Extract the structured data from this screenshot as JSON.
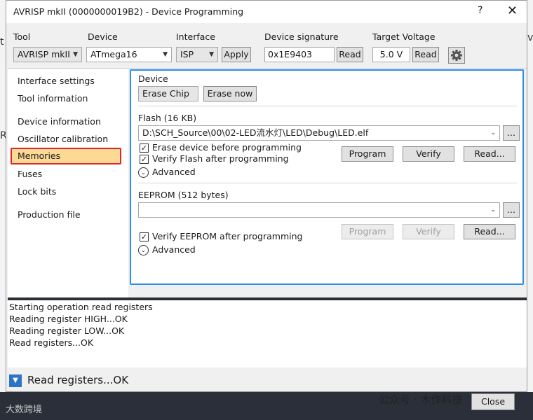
{
  "window": {
    "title": "AVRISP mkII (0000000019B2) - Device Programming",
    "help": "?",
    "close": "✕"
  },
  "toolbar": {
    "tool_label": "Tool",
    "tool_value": "AVRISP mkII",
    "device_label": "Device",
    "device_value": "ATmega16",
    "interface_label": "Interface",
    "interface_value": "ISP",
    "apply": "Apply",
    "signature_label": "Device signature",
    "signature_value": "0x1E9403",
    "signature_read": "Read",
    "voltage_label": "Target Voltage",
    "voltage_value": "5.0 V",
    "voltage_read": "Read"
  },
  "nav": {
    "items": [
      "Interface settings",
      "Tool information",
      "Device information",
      "Oscillator calibration",
      "Memories",
      "Fuses",
      "Lock bits",
      "Production file"
    ],
    "active": "Memories"
  },
  "memories": {
    "device_heading": "Device",
    "erase_mode": "Erase Chip",
    "erase_now": "Erase now",
    "flash_heading": "Flash (16 KB)",
    "flash_path": "D:\\SCH_Source\\00\\02-LED流水灯\\LED\\Debug\\LED.elf",
    "browse": "...",
    "erase_before": "Erase device before programming",
    "verify_flash": "Verify Flash after programming",
    "erase_before_checked": "✓",
    "verify_flash_checked": "✓",
    "program": "Program",
    "verify": "Verify",
    "read": "Read...",
    "advanced": "Advanced",
    "eeprom_heading": "EEPROM (512 bytes)",
    "eeprom_path": "",
    "verify_eeprom": "Verify EEPROM after programming",
    "verify_eeprom_checked": "✓"
  },
  "log": {
    "lines": [
      "Starting operation read registers",
      "Reading register HIGH...OK",
      "Reading register LOW...OK",
      "Read registers...OK"
    ]
  },
  "status": {
    "text": "Read registers...OK"
  },
  "footer": {
    "close": "Close",
    "watermark_left": "大数跨境",
    "watermark_right": "公众号 · 木作科技"
  },
  "icons": {
    "gear": "gear-icon",
    "dropdown": "chevron-down-icon",
    "expander": "chevron-down-circle-icon",
    "status": "triangle-down-icon"
  },
  "colors": {
    "active_nav_bg": "#fcd995",
    "active_nav_border": "#e0262d",
    "content_border": "#2d8fe3",
    "status_button": "#2b74c7"
  }
}
